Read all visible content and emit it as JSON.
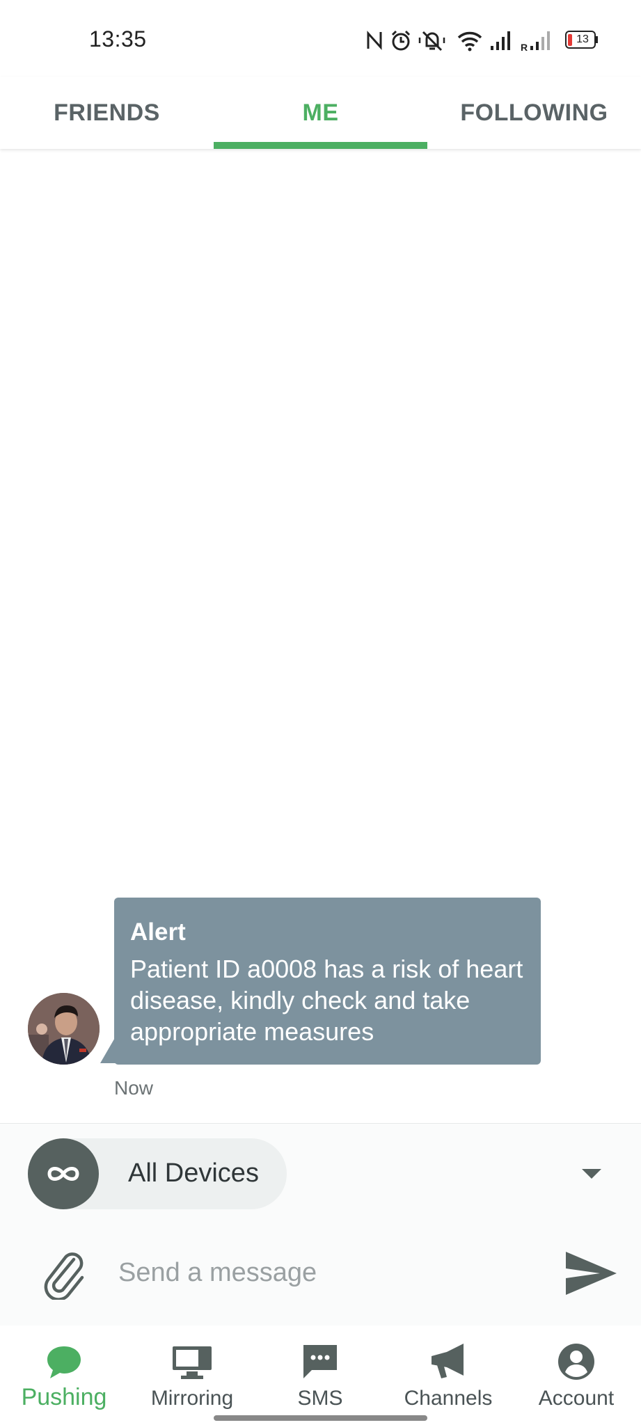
{
  "status_bar": {
    "time": "13:35",
    "battery": "13",
    "icons": [
      "nfc-icon",
      "alarm-icon",
      "mute-icon",
      "wifi-icon",
      "signal-icon",
      "roaming-signal-icon",
      "battery-icon"
    ]
  },
  "tabs": [
    {
      "label": "FRIENDS",
      "active": false
    },
    {
      "label": "ME",
      "active": true
    },
    {
      "label": "FOLLOWING",
      "active": false
    }
  ],
  "message": {
    "title": "Alert",
    "body": "Patient ID a0008 has a risk of heart disease, kindly check and take appropriate measures",
    "time": "Now"
  },
  "device_selector": {
    "label": "All Devices",
    "icon": "infinity-icon"
  },
  "compose": {
    "placeholder": "Send a message"
  },
  "bottom_nav": [
    {
      "label": "Pushing",
      "icon": "chat-bubble-icon",
      "active": true
    },
    {
      "label": "Mirroring",
      "icon": "monitor-icon",
      "active": false
    },
    {
      "label": "SMS",
      "icon": "sms-icon",
      "active": false
    },
    {
      "label": "Channels",
      "icon": "megaphone-icon",
      "active": false
    },
    {
      "label": "Account",
      "icon": "account-icon",
      "active": false
    }
  ],
  "colors": {
    "accent": "#4caf62",
    "bubble": "#7d929e",
    "dark_icon": "#56615f"
  }
}
